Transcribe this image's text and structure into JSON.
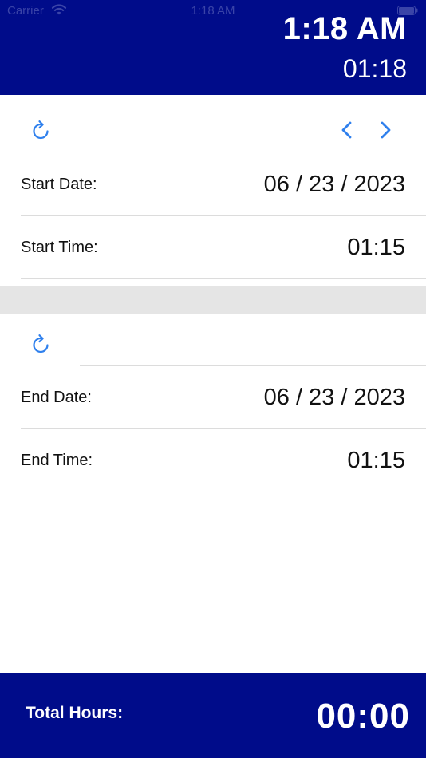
{
  "status_bar": {
    "carrier": "Carrier",
    "time": "1:18 AM"
  },
  "header": {
    "clock_main": "1:18 AM",
    "clock_sub": "01:18",
    "background_color": "#000c8a"
  },
  "start_section": {
    "start_date_label": "Start Date:",
    "start_date_value": "06 / 23 / 2023",
    "start_time_label": "Start Time:",
    "start_time_value": "01:15"
  },
  "end_section": {
    "end_date_label": "End Date:",
    "end_date_value": "06 / 23 / 2023",
    "end_time_label": "End Time:",
    "end_time_value": "01:15"
  },
  "footer": {
    "total_label": "Total Hours:",
    "total_value": "00:00"
  },
  "icons": {
    "refresh": "refresh-icon",
    "previous": "chevron-left-icon",
    "next": "chevron-right-icon",
    "wifi": "wifi-icon",
    "battery": "battery-icon"
  },
  "colors": {
    "accent": "#2f80ed",
    "divider": "#dcdcdc",
    "band": "#e5e5e5"
  }
}
